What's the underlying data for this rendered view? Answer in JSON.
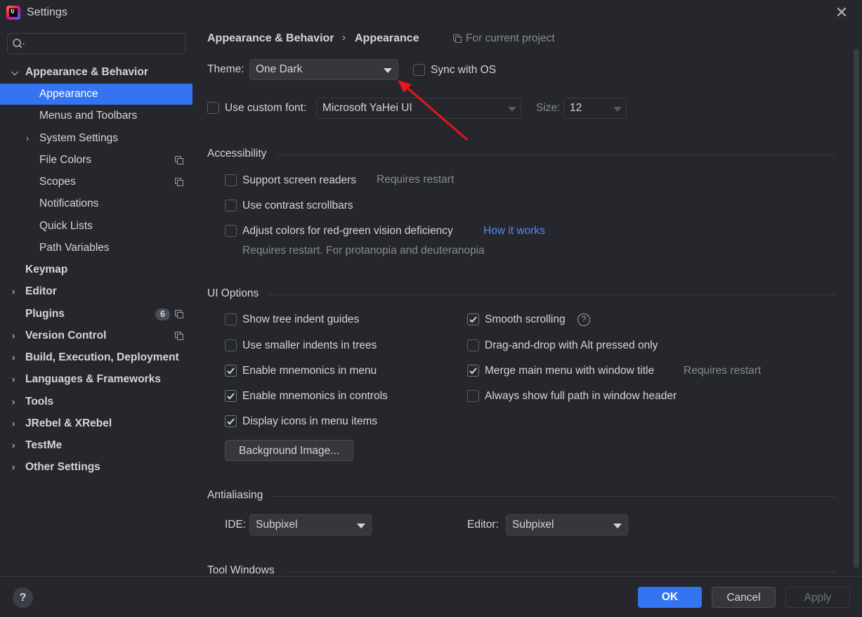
{
  "window": {
    "title": "Settings"
  },
  "search": {
    "placeholder": ""
  },
  "sidebar": {
    "items": [
      {
        "label": "Appearance & Behavior",
        "expanded": true
      },
      {
        "label": "Appearance",
        "selected": true
      },
      {
        "label": "Menus and Toolbars"
      },
      {
        "label": "System Settings"
      },
      {
        "label": "File Colors"
      },
      {
        "label": "Scopes"
      },
      {
        "label": "Notifications"
      },
      {
        "label": "Quick Lists"
      },
      {
        "label": "Path Variables"
      },
      {
        "label": "Keymap"
      },
      {
        "label": "Editor"
      },
      {
        "label": "Plugins",
        "badge": "6"
      },
      {
        "label": "Version Control"
      },
      {
        "label": "Build, Execution, Deployment"
      },
      {
        "label": "Languages & Frameworks"
      },
      {
        "label": "Tools"
      },
      {
        "label": "JRebel & XRebel"
      },
      {
        "label": "TestMe"
      },
      {
        "label": "Other Settings"
      }
    ]
  },
  "breadcrumb": {
    "parent": "Appearance & Behavior",
    "separator": "›",
    "current": "Appearance",
    "scope": "For current project"
  },
  "theme": {
    "label": "Theme:",
    "value": "One Dark",
    "sync_label": "Sync with OS",
    "sync_checked": false
  },
  "font": {
    "use_custom_label": "Use custom font:",
    "use_custom_checked": false,
    "family": "Microsoft YaHei UI",
    "size_label": "Size:",
    "size": "12"
  },
  "accessibility": {
    "title": "Accessibility",
    "screen_readers": {
      "label": "Support screen readers",
      "note": "Requires restart",
      "checked": false
    },
    "contrast_scrollbars": {
      "label": "Use contrast scrollbars",
      "checked": false
    },
    "color_deficiency": {
      "label": "Adjust colors for red-green vision deficiency",
      "link": "How it works",
      "note": "Requires restart. For protanopia and deuteranopia",
      "checked": false
    }
  },
  "ui_options": {
    "title": "UI Options",
    "left": [
      {
        "label": "Show tree indent guides",
        "checked": false
      },
      {
        "label": "Use smaller indents in trees",
        "checked": false
      },
      {
        "label": "Enable mnemonics in menu",
        "checked": true
      },
      {
        "label": "Enable mnemonics in controls",
        "checked": true
      },
      {
        "label": "Display icons in menu items",
        "checked": true
      }
    ],
    "right": [
      {
        "label": "Smooth scrolling",
        "checked": true,
        "help": "?"
      },
      {
        "label": "Drag-and-drop with Alt pressed only",
        "checked": false
      },
      {
        "label": "Merge main menu with window title",
        "checked": true,
        "note": "Requires restart"
      },
      {
        "label": "Always show full path in window header",
        "checked": false
      }
    ],
    "background_button": "Background Image..."
  },
  "antialiasing": {
    "title": "Antialiasing",
    "ide_label": "IDE:",
    "ide_value": "Subpixel",
    "editor_label": "Editor:",
    "editor_value": "Subpixel"
  },
  "tool_windows": {
    "title": "Tool Windows"
  },
  "footer": {
    "help": "?",
    "ok": "OK",
    "cancel": "Cancel",
    "apply": "Apply"
  },
  "colors": {
    "accent": "#3574f0",
    "background": "#25272c",
    "link": "#548af7",
    "annotation_arrow": "#e8141e"
  }
}
